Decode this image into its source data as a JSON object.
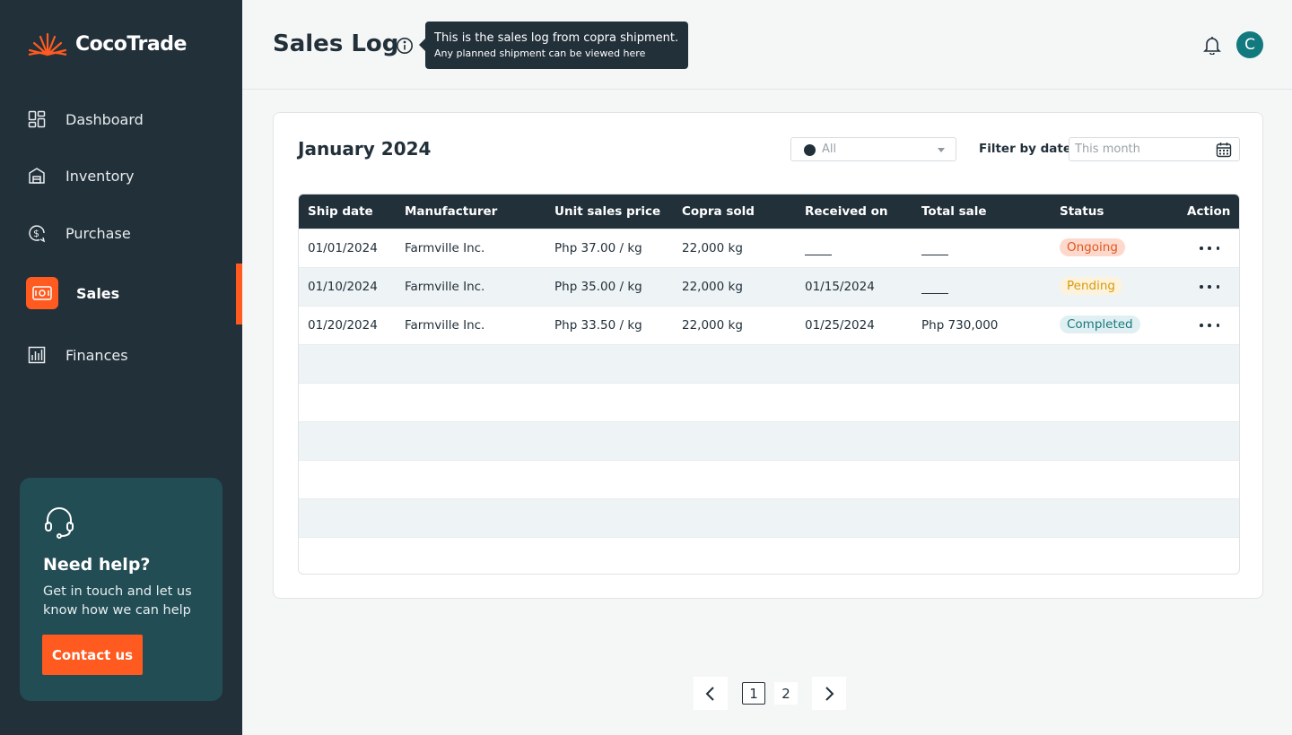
{
  "brand": {
    "name": "CocoTrade"
  },
  "sidebar": {
    "items": [
      {
        "label": "Dashboard",
        "icon": "dashboard-icon"
      },
      {
        "label": "Inventory",
        "icon": "warehouse-icon"
      },
      {
        "label": "Purchase",
        "icon": "purchase-icon"
      },
      {
        "label": "Sales",
        "icon": "sales-icon",
        "active": true
      },
      {
        "label": "Finances",
        "icon": "chart-icon"
      }
    ],
    "help": {
      "title": "Need help?",
      "text": "Get in touch and let us know how we can help",
      "button": "Contact us"
    }
  },
  "header": {
    "title": "Sales Log",
    "tooltip_line1": "This is the sales log from copra shipment.",
    "tooltip_line2": "Any planned shipment can be viewed here",
    "avatar_initial": "C"
  },
  "card": {
    "title": "January 2024",
    "status_filter": "All",
    "filter_label": "Filter by date",
    "date_value": "This month"
  },
  "table": {
    "columns": [
      "Ship date",
      "Manufacturer",
      "Unit sales price",
      "Copra sold",
      "Received on",
      "Total sale",
      "Status",
      "Action"
    ],
    "rows": [
      {
        "ship_date": "01/01/2024",
        "manufacturer": "Farmville Inc.",
        "unit_price": "Php 37.00 / kg",
        "copra_sold": "22,000 kg",
        "received_on": "",
        "total_sale": "",
        "status": "Ongoing"
      },
      {
        "ship_date": "01/10/2024",
        "manufacturer": "Farmville Inc.",
        "unit_price": "Php 35.00 / kg",
        "copra_sold": "22,000 kg",
        "received_on": "01/15/2024",
        "total_sale": "",
        "status": "Pending"
      },
      {
        "ship_date": "01/20/2024",
        "manufacturer": "Farmville Inc.",
        "unit_price": "Php 33.50 / kg",
        "copra_sold": "22,000 kg",
        "received_on": "01/25/2024",
        "total_sale": "Php 730,000",
        "status": "Completed"
      }
    ]
  },
  "pagination": {
    "pages": [
      "1",
      "2"
    ],
    "current": "1"
  },
  "colors": {
    "sidebar": "#22303a",
    "accent": "#ff5a1f",
    "help_card": "#234d55",
    "avatar": "#127a7f"
  }
}
